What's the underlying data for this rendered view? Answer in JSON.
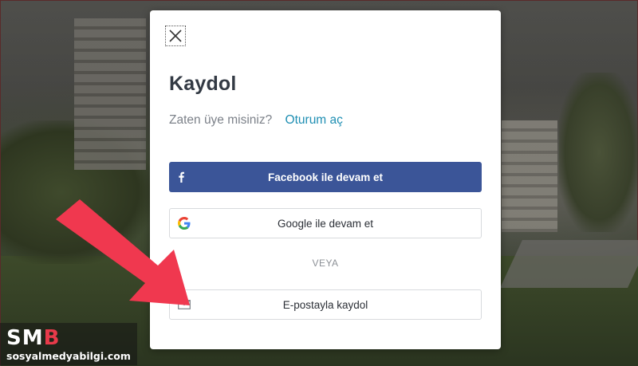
{
  "modal": {
    "close_icon": "close-icon",
    "title": "Kaydol",
    "member_prompt": "Zaten üye misiniz?",
    "login_link": "Oturum aç",
    "facebook_button": {
      "label": "Facebook ile devam et",
      "icon": "facebook-icon",
      "color": "#3b5598"
    },
    "google_button": {
      "label": "Google ile devam et",
      "icon": "google-icon"
    },
    "separator": "VEYA",
    "email_button": {
      "label": "E-postayla kaydol",
      "icon": "envelope-icon"
    },
    "link_color": "#1f8fb3"
  },
  "overlay": {
    "arrow_icon": "pointer-arrow-icon",
    "arrow_color": "#f0384f"
  },
  "watermark": {
    "logo_prefix": "SM",
    "logo_suffix": "B",
    "domain": "sosyalmedyabilgi.com"
  }
}
